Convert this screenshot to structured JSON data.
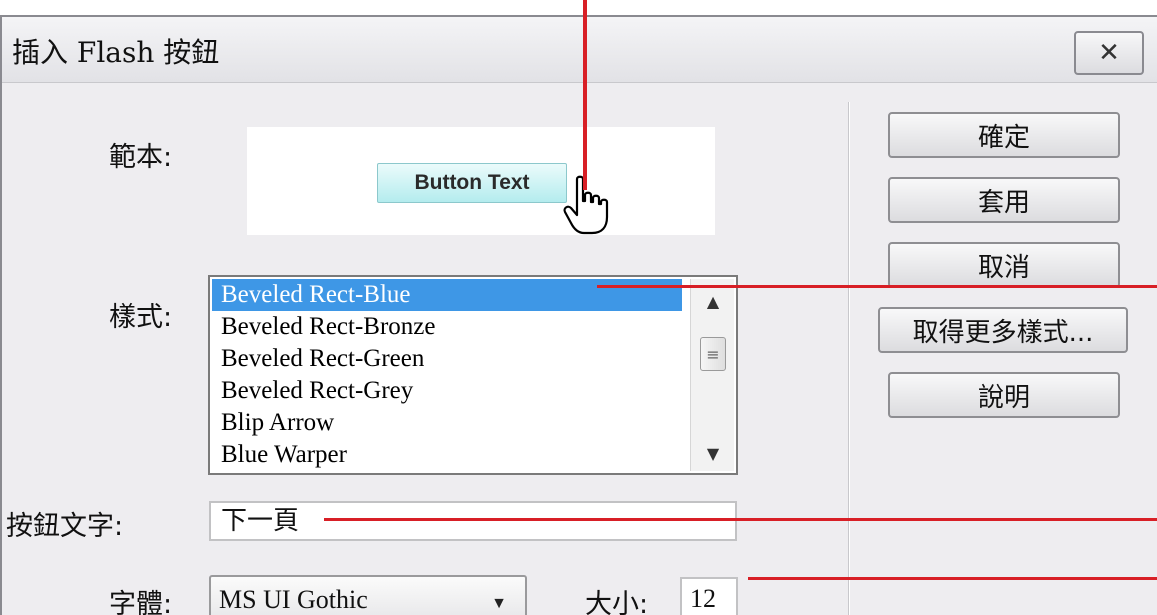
{
  "window": {
    "title": "插入 Flash 按鈕",
    "close_icon": "close-icon"
  },
  "form": {
    "sample_label": "範本:",
    "style_label": "樣式:",
    "button_text_label": "按鈕文字:",
    "font_label": "字體:",
    "size_label": "大小:"
  },
  "preview": {
    "button_text": "Button Text",
    "cursor_icon": "hand-pointer-icon"
  },
  "style_list": {
    "items": [
      "Beveled Rect-Blue",
      "Beveled Rect-Bronze",
      "Beveled Rect-Green",
      "Beveled Rect-Grey",
      "Blip Arrow",
      "Blue Warper"
    ],
    "selected": "Beveled Rect-Blue"
  },
  "fields": {
    "button_text_value": "下一頁",
    "font_value": "MS UI Gothic",
    "size_value": "12"
  },
  "buttons": {
    "ok": "確定",
    "apply": "套用",
    "cancel": "取消",
    "get_more_styles": "取得更多樣式...",
    "help": "說明"
  },
  "colors": {
    "selection": "#3e97e6",
    "annotation": "#d81f26",
    "preview_button": "#b4ecee"
  }
}
